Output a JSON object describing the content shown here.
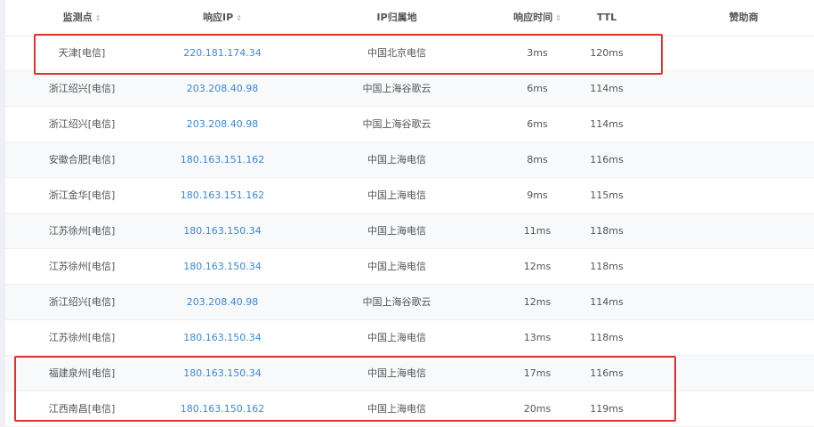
{
  "header": {
    "point": "监测点",
    "ip": "响应IP",
    "location": "IP归属地",
    "time": "响应时间",
    "ttl": "TTL",
    "sponsor": "赞助商",
    "sort_icon": "sort-arrows-icon"
  },
  "rows": [
    {
      "point": "天津[电信]",
      "ip": "220.181.174.34",
      "location": "中国北京电信",
      "time": "3ms",
      "ttl": "120ms"
    },
    {
      "point": "浙江绍兴[电信]",
      "ip": "203.208.40.98",
      "location": "中国上海谷歌云",
      "time": "6ms",
      "ttl": "114ms"
    },
    {
      "point": "浙江绍兴[电信]",
      "ip": "203.208.40.98",
      "location": "中国上海谷歌云",
      "time": "6ms",
      "ttl": "114ms"
    },
    {
      "point": "安徽合肥[电信]",
      "ip": "180.163.151.162",
      "location": "中国上海电信",
      "time": "8ms",
      "ttl": "116ms"
    },
    {
      "point": "浙江金华[电信]",
      "ip": "180.163.151.162",
      "location": "中国上海电信",
      "time": "9ms",
      "ttl": "115ms"
    },
    {
      "point": "江苏徐州[电信]",
      "ip": "180.163.150.34",
      "location": "中国上海电信",
      "time": "11ms",
      "ttl": "118ms"
    },
    {
      "point": "江苏徐州[电信]",
      "ip": "180.163.150.34",
      "location": "中国上海电信",
      "time": "12ms",
      "ttl": "118ms"
    },
    {
      "point": "浙江绍兴[电信]",
      "ip": "203.208.40.98",
      "location": "中国上海谷歌云",
      "time": "12ms",
      "ttl": "114ms"
    },
    {
      "point": "江苏徐州[电信]",
      "ip": "180.163.150.34",
      "location": "中国上海电信",
      "time": "13ms",
      "ttl": "118ms"
    },
    {
      "point": "福建泉州[电信]",
      "ip": "180.163.150.34",
      "location": "中国上海电信",
      "time": "17ms",
      "ttl": "116ms"
    },
    {
      "point": "江西南昌[电信]",
      "ip": "180.163.150.162",
      "location": "中国上海电信",
      "time": "20ms",
      "ttl": "119ms"
    }
  ],
  "colors": {
    "ip_link": "#3a87d9",
    "highlight_border": "#e0332b",
    "alt_row": "#f8f9fb"
  }
}
